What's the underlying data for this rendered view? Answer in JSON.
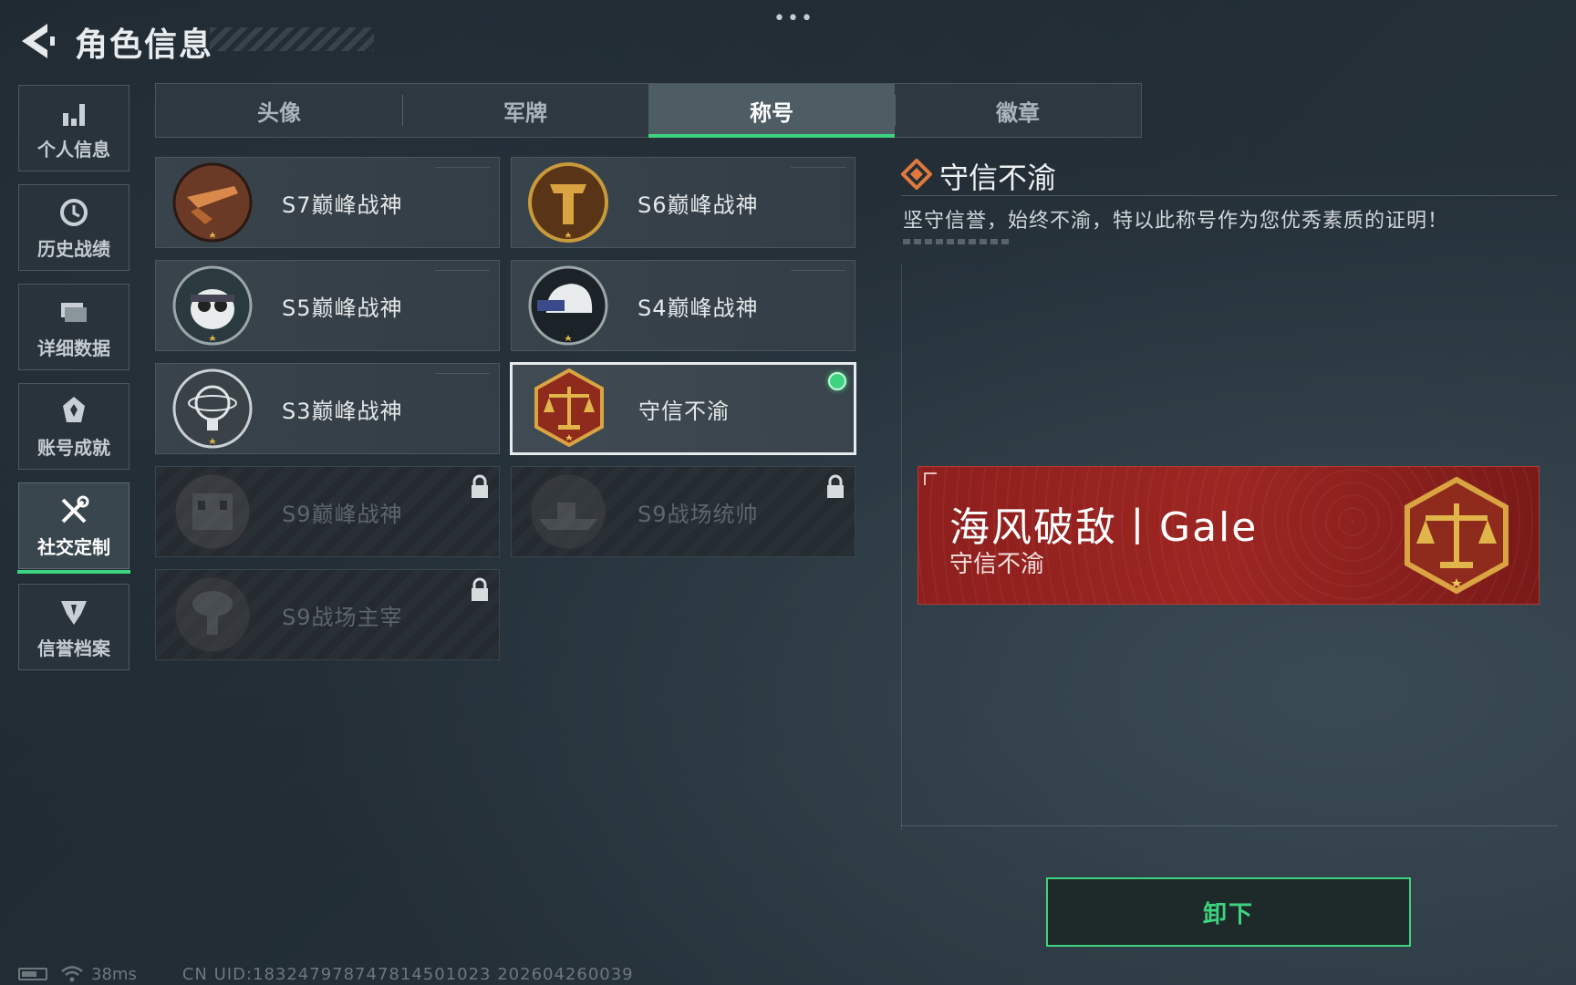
{
  "header": {
    "title": "角色信息",
    "dots": "•••"
  },
  "sidebar": {
    "items": [
      {
        "label": "个人信息",
        "icon": "bar-chart-icon"
      },
      {
        "label": "历史战绩",
        "icon": "history-clock-icon"
      },
      {
        "label": "详细数据",
        "icon": "folder-icon"
      },
      {
        "label": "账号成就",
        "icon": "medal-icon"
      },
      {
        "label": "社交定制",
        "icon": "tools-icon",
        "active": true
      },
      {
        "label": "信誉档案",
        "icon": "shield-emblem-icon"
      }
    ]
  },
  "tabs": [
    {
      "label": "头像"
    },
    {
      "label": "军牌"
    },
    {
      "label": "称号",
      "active": true
    },
    {
      "label": "徽章"
    }
  ],
  "titles": [
    {
      "name": "S7巅峰战神",
      "badge": "crossbow-badge-icon",
      "locked": false
    },
    {
      "name": "S6巅峰战神",
      "badge": "t-shield-badge-icon",
      "locked": false
    },
    {
      "name": "S5巅峰战神",
      "badge": "diver-skull-badge-icon",
      "locked": false
    },
    {
      "name": "S4巅峰战神",
      "badge": "nightvision-helmet-badge-icon",
      "locked": false
    },
    {
      "name": "S3巅峰战神",
      "badge": "globe-badge-icon",
      "locked": false
    },
    {
      "name": "守信不渝",
      "badge": "scales-badge-icon",
      "locked": false,
      "selected": true,
      "equipped": true
    },
    {
      "name": "S9巅峰战神",
      "badge": "building-badge-icon",
      "locked": true
    },
    {
      "name": "S9战场统帅",
      "badge": "warship-badge-icon",
      "locked": true
    },
    {
      "name": "S9战场主宰",
      "badge": "mushroom-cloud-badge-icon",
      "locked": true
    }
  ],
  "detail": {
    "title": "守信不渝",
    "description": "坚守信誉，始终不渝，特以此称号作为您优秀素质的证明！",
    "banner": {
      "player_name": "海风破敌丨Gale",
      "title": "守信不渝"
    }
  },
  "actions": {
    "unequip_label": "卸下"
  },
  "footer": {
    "ping": "38ms",
    "uid": "CN UID:183247978747814501023 202604260039"
  },
  "colors": {
    "accent": "#3ed37f",
    "banner": "#9c2622",
    "badge_gold": "#d9a441"
  }
}
